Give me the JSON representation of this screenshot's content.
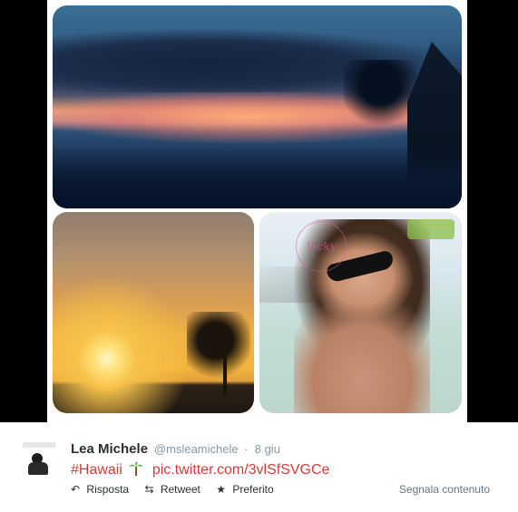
{
  "tweet": {
    "name": "Lea Michele",
    "handle": "@msleamichele",
    "separator": "·",
    "time": "8 giu",
    "hashtag": "#Hawaii",
    "link": "pic.twitter.com/3vlSfSVGCe",
    "palm_icon": "palm-tree-icon",
    "actions": {
      "reply": "Risposta",
      "retweet": "Retweet",
      "favorite": "Preferito"
    },
    "report": "Segnala contenuto"
  },
  "collage": {
    "watermark_text": "Vicky"
  },
  "colors": {
    "link": "#d63b3b",
    "name": "#292f33",
    "meta": "#8899a6"
  }
}
